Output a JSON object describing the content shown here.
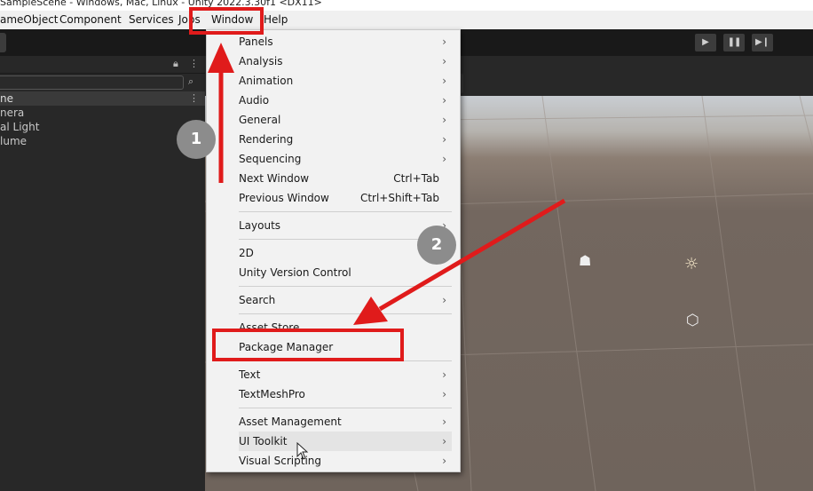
{
  "window": {
    "title": "SampleScene - Windows, Mac, Linux - Unity 2022.3.30f1 <DX11>"
  },
  "menubar": {
    "items": [
      "ameObject",
      "Component",
      "Services",
      "Jobs",
      "Window",
      "Help"
    ]
  },
  "toolbar": {
    "play_icon": "play-icon",
    "pause_icon": "pause-icon",
    "step_icon": "step-icon"
  },
  "hierarchy": {
    "scene_label": "ne",
    "items": [
      "nera",
      "al Light",
      "lume"
    ]
  },
  "window_menu": {
    "items": [
      {
        "label": "Panels",
        "submenu": true
      },
      {
        "label": "Analysis",
        "submenu": true
      },
      {
        "label": "Animation",
        "submenu": true
      },
      {
        "label": "Audio",
        "submenu": true
      },
      {
        "label": "General",
        "submenu": true
      },
      {
        "label": "Rendering",
        "submenu": true
      },
      {
        "label": "Sequencing",
        "submenu": true
      },
      {
        "label": "Next Window",
        "shortcut": "Ctrl+Tab"
      },
      {
        "label": "Previous Window",
        "shortcut": "Ctrl+Shift+Tab"
      },
      {
        "label": "Layouts",
        "submenu": true
      },
      {
        "label": "2D"
      },
      {
        "label": "Unity Version Control"
      },
      {
        "label": "Search",
        "submenu": true
      },
      {
        "label": "Asset Store"
      },
      {
        "label": "Package Manager"
      },
      {
        "label": "Text",
        "submenu": true
      },
      {
        "label": "TextMeshPro",
        "submenu": true
      },
      {
        "label": "Asset Management",
        "submenu": true
      },
      {
        "label": "UI Toolkit",
        "submenu": true
      },
      {
        "label": "Visual Scripting",
        "submenu": true
      }
    ],
    "arrow_glyph": "›"
  },
  "annotations": {
    "step1": "1",
    "step2": "2",
    "color": "#e01b1b"
  },
  "scene": {
    "camera_icon": "camera-gizmo-icon",
    "light_icon": "sun-gizmo-icon",
    "volume_icon": "cube-gizmo-icon"
  }
}
